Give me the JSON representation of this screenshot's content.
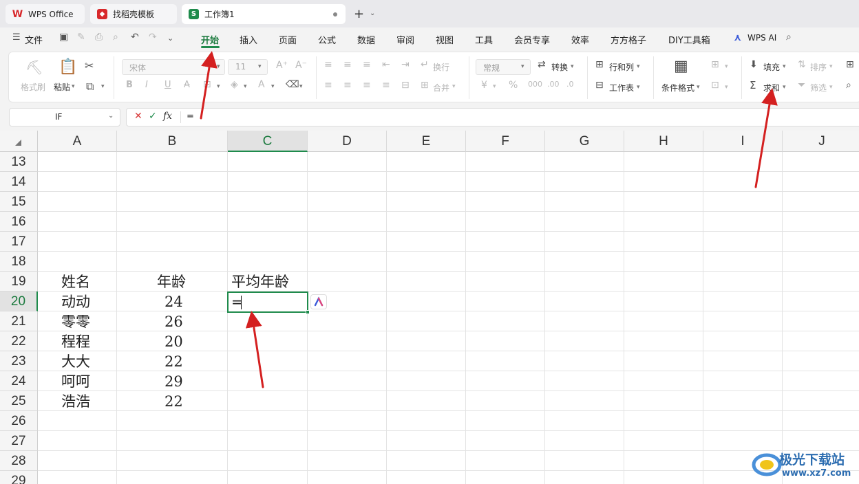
{
  "tabs": {
    "wps": "WPS Office",
    "template": "找稻壳模板",
    "workbook": "工作簿1",
    "add": "+"
  },
  "menu": {
    "file": "文件",
    "items": [
      "开始",
      "插入",
      "页面",
      "公式",
      "数据",
      "审阅",
      "视图",
      "工具",
      "会员专享",
      "效率",
      "方方格子",
      "DIY工具箱"
    ],
    "wps_ai": "WPS AI"
  },
  "ribbon": {
    "format_painter": "格式刷",
    "paste": "粘贴",
    "font_name": "宋体",
    "font_size": "11",
    "wrap": "换行",
    "merge": "合并",
    "number_format": "常规",
    "convert": "转换",
    "row_col": "行和列",
    "worksheet": "工作表",
    "cond_format": "条件格式",
    "fill": "填充",
    "sort": "排序",
    "sum": "求和",
    "filter": "筛选"
  },
  "formula_bar": {
    "name_box": "IF",
    "value": "="
  },
  "columns": [
    "A",
    "B",
    "C",
    "D",
    "E",
    "F",
    "G",
    "H",
    "I",
    "J"
  ],
  "rows": [
    "13",
    "14",
    "15",
    "16",
    "17",
    "18",
    "19",
    "20",
    "21",
    "22",
    "23",
    "24",
    "25",
    "26",
    "27",
    "28",
    "29"
  ],
  "table": {
    "header_name": "姓名",
    "header_age": "年龄",
    "header_avg": "平均年龄",
    "names": [
      "动动",
      "零零",
      "程程",
      "大大",
      "呵呵",
      "浩浩"
    ],
    "ages": [
      "24",
      "26",
      "20",
      "22",
      "29",
      "22"
    ],
    "active_value": "="
  },
  "watermark": {
    "title": "极光下载站",
    "url": "www.xz7.com"
  },
  "colors": {
    "accent": "#1f8b4c",
    "arrow": "#d42020"
  }
}
